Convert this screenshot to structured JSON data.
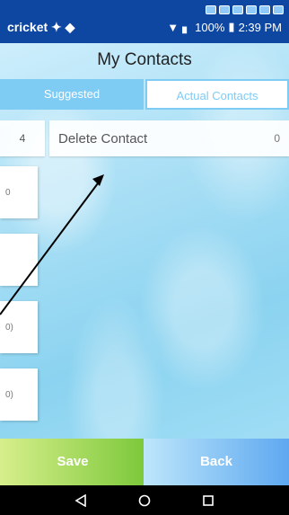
{
  "status": {
    "carrier": "cricket",
    "battery": "100%",
    "time": "2:39 PM"
  },
  "header": {
    "title": "My Contacts"
  },
  "tabs": {
    "suggested": "Suggested",
    "actual": "Actual Contacts"
  },
  "row": {
    "index": "4",
    "label": "Delete Contact",
    "count": "0"
  },
  "side_cards": [
    "0",
    "",
    "0)",
    "0)"
  ],
  "buttons": {
    "save": "Save",
    "back": "Back"
  },
  "colors": {
    "status_bar": "#0d47a1",
    "tab_accent": "#7ecbf4",
    "save_green": "#7cc83a",
    "back_blue": "#5ea8f0"
  },
  "icons": {
    "nav": [
      "back-triangle-icon",
      "home-circle-icon",
      "recents-square-icon"
    ]
  }
}
